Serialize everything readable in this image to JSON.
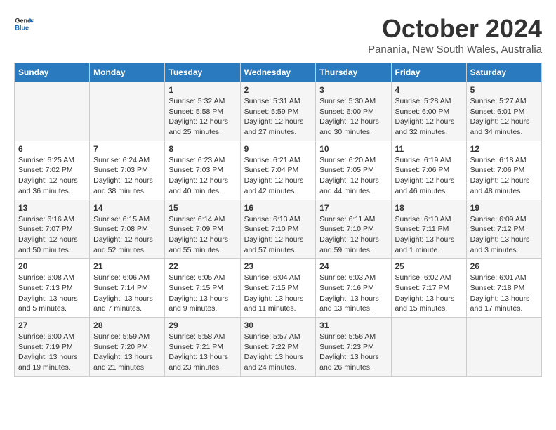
{
  "logo": {
    "line1": "General",
    "line2": "Blue"
  },
  "title": "October 2024",
  "location": "Panania, New South Wales, Australia",
  "days_of_week": [
    "Sunday",
    "Monday",
    "Tuesday",
    "Wednesday",
    "Thursday",
    "Friday",
    "Saturday"
  ],
  "weeks": [
    [
      {
        "day": "",
        "info": ""
      },
      {
        "day": "",
        "info": ""
      },
      {
        "day": "1",
        "info": "Sunrise: 5:32 AM\nSunset: 5:58 PM\nDaylight: 12 hours\nand 25 minutes."
      },
      {
        "day": "2",
        "info": "Sunrise: 5:31 AM\nSunset: 5:59 PM\nDaylight: 12 hours\nand 27 minutes."
      },
      {
        "day": "3",
        "info": "Sunrise: 5:30 AM\nSunset: 6:00 PM\nDaylight: 12 hours\nand 30 minutes."
      },
      {
        "day": "4",
        "info": "Sunrise: 5:28 AM\nSunset: 6:00 PM\nDaylight: 12 hours\nand 32 minutes."
      },
      {
        "day": "5",
        "info": "Sunrise: 5:27 AM\nSunset: 6:01 PM\nDaylight: 12 hours\nand 34 minutes."
      }
    ],
    [
      {
        "day": "6",
        "info": "Sunrise: 6:25 AM\nSunset: 7:02 PM\nDaylight: 12 hours\nand 36 minutes."
      },
      {
        "day": "7",
        "info": "Sunrise: 6:24 AM\nSunset: 7:03 PM\nDaylight: 12 hours\nand 38 minutes."
      },
      {
        "day": "8",
        "info": "Sunrise: 6:23 AM\nSunset: 7:03 PM\nDaylight: 12 hours\nand 40 minutes."
      },
      {
        "day": "9",
        "info": "Sunrise: 6:21 AM\nSunset: 7:04 PM\nDaylight: 12 hours\nand 42 minutes."
      },
      {
        "day": "10",
        "info": "Sunrise: 6:20 AM\nSunset: 7:05 PM\nDaylight: 12 hours\nand 44 minutes."
      },
      {
        "day": "11",
        "info": "Sunrise: 6:19 AM\nSunset: 7:06 PM\nDaylight: 12 hours\nand 46 minutes."
      },
      {
        "day": "12",
        "info": "Sunrise: 6:18 AM\nSunset: 7:06 PM\nDaylight: 12 hours\nand 48 minutes."
      }
    ],
    [
      {
        "day": "13",
        "info": "Sunrise: 6:16 AM\nSunset: 7:07 PM\nDaylight: 12 hours\nand 50 minutes."
      },
      {
        "day": "14",
        "info": "Sunrise: 6:15 AM\nSunset: 7:08 PM\nDaylight: 12 hours\nand 52 minutes."
      },
      {
        "day": "15",
        "info": "Sunrise: 6:14 AM\nSunset: 7:09 PM\nDaylight: 12 hours\nand 55 minutes."
      },
      {
        "day": "16",
        "info": "Sunrise: 6:13 AM\nSunset: 7:10 PM\nDaylight: 12 hours\nand 57 minutes."
      },
      {
        "day": "17",
        "info": "Sunrise: 6:11 AM\nSunset: 7:10 PM\nDaylight: 12 hours\nand 59 minutes."
      },
      {
        "day": "18",
        "info": "Sunrise: 6:10 AM\nSunset: 7:11 PM\nDaylight: 13 hours\nand 1 minute."
      },
      {
        "day": "19",
        "info": "Sunrise: 6:09 AM\nSunset: 7:12 PM\nDaylight: 13 hours\nand 3 minutes."
      }
    ],
    [
      {
        "day": "20",
        "info": "Sunrise: 6:08 AM\nSunset: 7:13 PM\nDaylight: 13 hours\nand 5 minutes."
      },
      {
        "day": "21",
        "info": "Sunrise: 6:06 AM\nSunset: 7:14 PM\nDaylight: 13 hours\nand 7 minutes."
      },
      {
        "day": "22",
        "info": "Sunrise: 6:05 AM\nSunset: 7:15 PM\nDaylight: 13 hours\nand 9 minutes."
      },
      {
        "day": "23",
        "info": "Sunrise: 6:04 AM\nSunset: 7:15 PM\nDaylight: 13 hours\nand 11 minutes."
      },
      {
        "day": "24",
        "info": "Sunrise: 6:03 AM\nSunset: 7:16 PM\nDaylight: 13 hours\nand 13 minutes."
      },
      {
        "day": "25",
        "info": "Sunrise: 6:02 AM\nSunset: 7:17 PM\nDaylight: 13 hours\nand 15 minutes."
      },
      {
        "day": "26",
        "info": "Sunrise: 6:01 AM\nSunset: 7:18 PM\nDaylight: 13 hours\nand 17 minutes."
      }
    ],
    [
      {
        "day": "27",
        "info": "Sunrise: 6:00 AM\nSunset: 7:19 PM\nDaylight: 13 hours\nand 19 minutes."
      },
      {
        "day": "28",
        "info": "Sunrise: 5:59 AM\nSunset: 7:20 PM\nDaylight: 13 hours\nand 21 minutes."
      },
      {
        "day": "29",
        "info": "Sunrise: 5:58 AM\nSunset: 7:21 PM\nDaylight: 13 hours\nand 23 minutes."
      },
      {
        "day": "30",
        "info": "Sunrise: 5:57 AM\nSunset: 7:22 PM\nDaylight: 13 hours\nand 24 minutes."
      },
      {
        "day": "31",
        "info": "Sunrise: 5:56 AM\nSunset: 7:23 PM\nDaylight: 13 hours\nand 26 minutes."
      },
      {
        "day": "",
        "info": ""
      },
      {
        "day": "",
        "info": ""
      }
    ]
  ]
}
